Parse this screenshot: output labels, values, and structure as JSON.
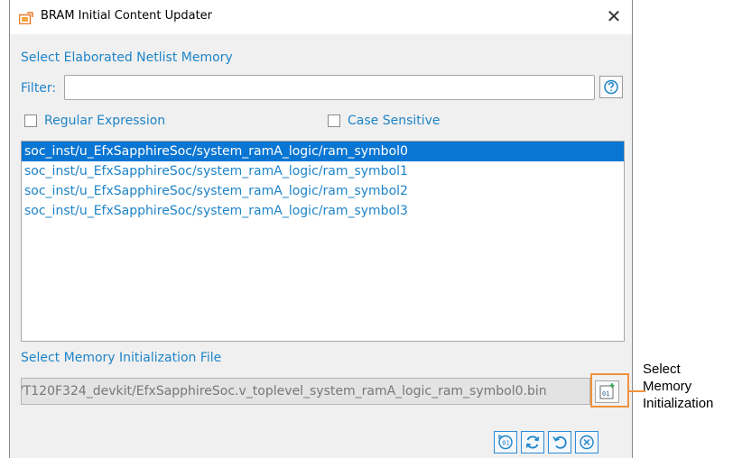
{
  "window": {
    "title": "BRAM Initial Content Updater",
    "close_glyph": "✕"
  },
  "netlist": {
    "heading": "Select Elaborated Netlist Memory",
    "filter_label": "Filter:",
    "filter_value": "",
    "regex_label": "Regular Expression",
    "case_label": "Case Sensitive",
    "items": [
      "soc_inst/u_EfxSapphireSoc/system_ramA_logic/ram_symbol0",
      "soc_inst/u_EfxSapphireSoc/system_ramA_logic/ram_symbol1",
      "soc_inst/u_EfxSapphireSoc/system_ramA_logic/ram_symbol2",
      "soc_inst/u_EfxSapphireSoc/system_ramA_logic/ram_symbol3"
    ],
    "selected_index": 0
  },
  "init_file": {
    "heading": "Select Memory Initialization File",
    "path": "/T120F324_devkit/EfxSapphireSoc.v_toplevel_system_ramA_logic_ram_symbol0.bin"
  },
  "callout": {
    "line1": "Select",
    "line2": "Memory",
    "line3": "Initialization"
  },
  "colors": {
    "accent": "#1e84c8",
    "selection": "#0a76d3",
    "callout": "#f0923a"
  },
  "icons": {
    "app": "app-icon",
    "help": "help-icon",
    "select_file": "select-file-icon",
    "generate": "generate-icon",
    "refresh": "refresh-icon",
    "undo": "undo-icon",
    "cancel": "cancel-icon"
  }
}
